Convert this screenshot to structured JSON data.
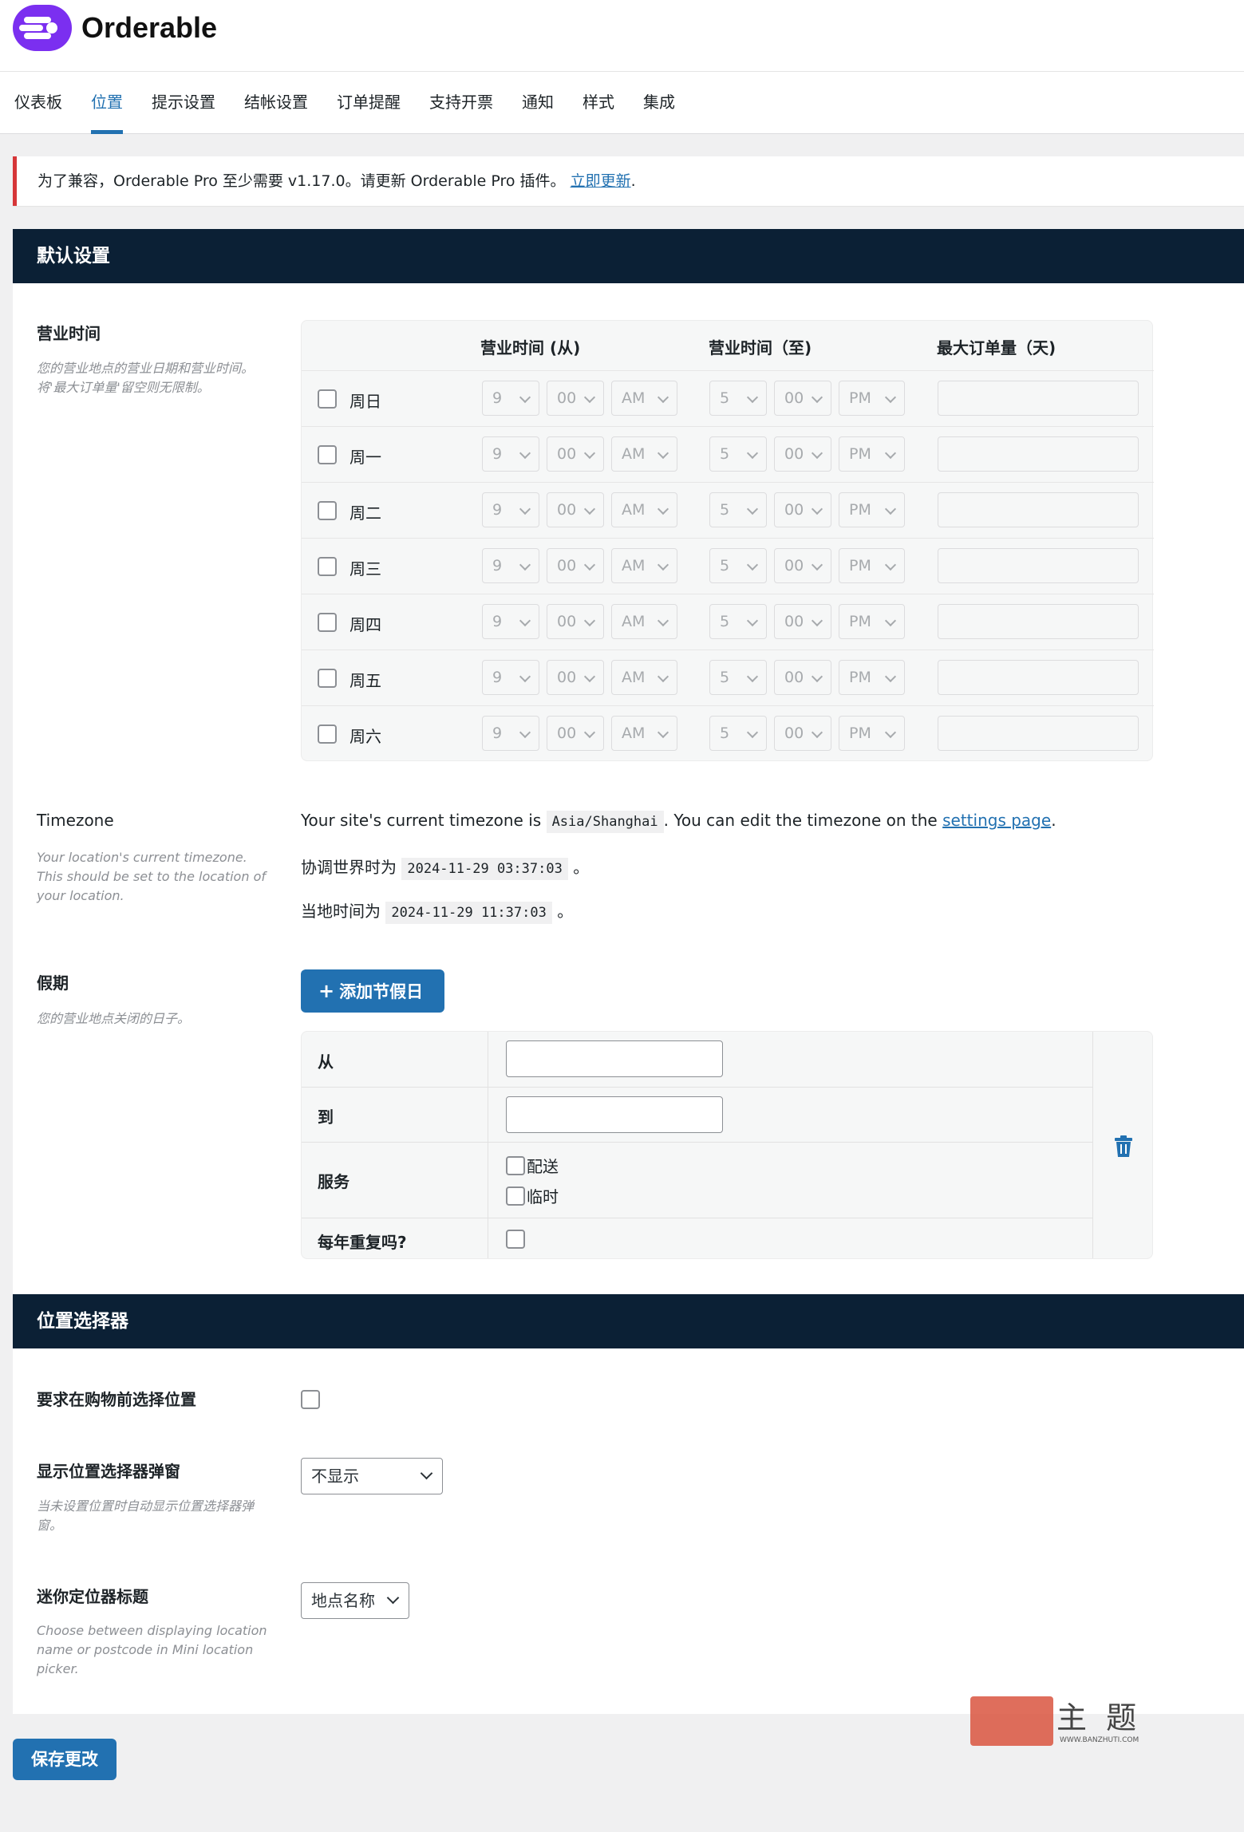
{
  "brand": {
    "name": "Orderable",
    "color": "#7b2ff0"
  },
  "tabs": [
    {
      "label": "仪表板",
      "active": false
    },
    {
      "label": "位置",
      "active": true
    },
    {
      "label": "提示设置",
      "active": false
    },
    {
      "label": "结帐设置",
      "active": false
    },
    {
      "label": "订单提醒",
      "active": false
    },
    {
      "label": "支持开票",
      "active": false
    },
    {
      "label": "通知",
      "active": false
    },
    {
      "label": "样式",
      "active": false
    },
    {
      "label": "集成",
      "active": false
    }
  ],
  "notice": {
    "text": "为了兼容，Orderable Pro 至少需要 v1.17.0。请更新 Orderable Pro 插件。",
    "link": "立即更新",
    "suffix": "."
  },
  "defaults": {
    "title": "默认设置",
    "hours": {
      "label": "营业时间",
      "desc": "您的营业地点的营业日期和营业时间。将'最大订单量'留空则无限制。",
      "col_from": "营业时间 (从)",
      "col_to": "营业时间（至)",
      "col_max": "最大订单量（天)",
      "from": {
        "hour": "9",
        "minute": "00",
        "ampm": "AM"
      },
      "to": {
        "hour": "5",
        "minute": "00",
        "ampm": "PM"
      },
      "days": [
        "周日",
        "周一",
        "周二",
        "周三",
        "周四",
        "周五",
        "周六"
      ]
    },
    "timezone": {
      "label": "Timezone",
      "desc": "Your location's current timezone. This should be set to the location of your location.",
      "line1_pre": "Your site's current timezone is",
      "tz": "Asia/Shanghai",
      "line1_mid": ". You can edit the timezone on the",
      "link": "settings page",
      "line1_end": ".",
      "utc_pre": "协调世界时为",
      "utc": "2024-11-29 03:37:03",
      "local_pre": "当地时间为",
      "local": "2024-11-29 11:37:03",
      "dot": "。"
    },
    "holiday": {
      "label": "假期",
      "desc": "您的营业地点关闭的日子。",
      "add_button": "添加节假日",
      "from": "从",
      "to": "到",
      "services": "服务",
      "service_delivery": "配送",
      "service_pickup": "临时",
      "repeat": "每年重复吗?"
    }
  },
  "selector": {
    "title": "位置选择器",
    "require_label": "要求在购物前选择位置",
    "popup_label": "显示位置选择器弹窗",
    "popup_desc": "当未设置位置时自动显示位置选择器弹窗。",
    "popup_value": "不显示",
    "mini_label": "迷你定位器标题",
    "mini_desc": "Choose between displaying location name or postcode in Mini location picker.",
    "mini_value": "地点名称"
  },
  "save_button": "保存更改",
  "watermark": {
    "main": "主 题",
    "sub": "WWW.BANZHUTI.COM"
  }
}
